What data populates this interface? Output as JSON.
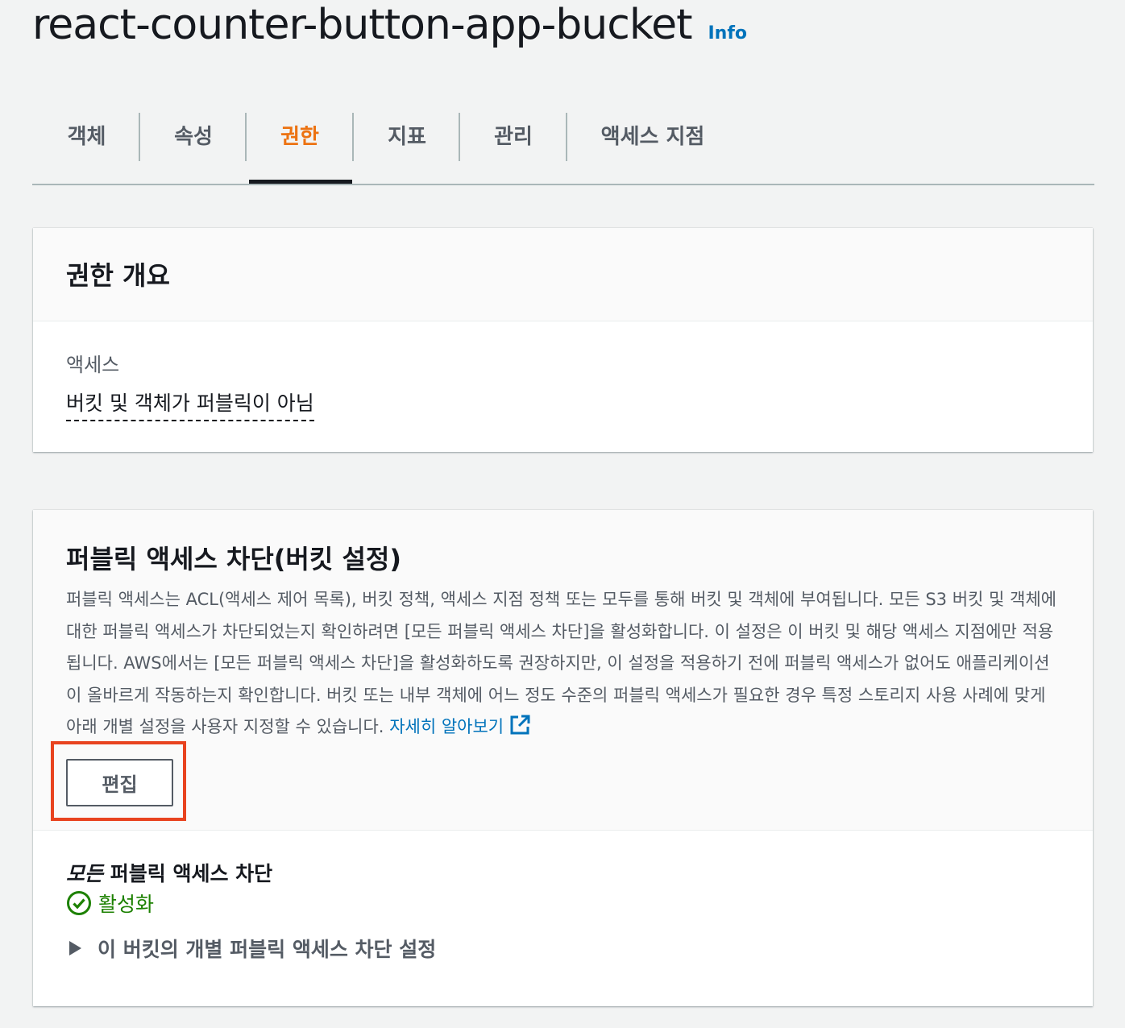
{
  "header": {
    "title": "react-counter-button-app-bucket",
    "info_label": "Info"
  },
  "tabs": [
    {
      "label": "객체"
    },
    {
      "label": "속성"
    },
    {
      "label": "권한",
      "active": true
    },
    {
      "label": "지표"
    },
    {
      "label": "관리"
    },
    {
      "label": "액세스 지점"
    }
  ],
  "overview": {
    "title": "권한 개요",
    "access_label": "액세스",
    "access_value": "버킷 및 객체가 퍼블릭이 아님"
  },
  "block_public_access": {
    "title": "퍼블릭 액세스 차단(버킷 설정)",
    "description": "퍼블릭 액세스는 ACL(액세스 제어 목록), 버킷 정책, 액세스 지점 정책 또는 모두를 통해 버킷 및 객체에 부여됩니다. 모든 S3 버킷 및 객체에 대한 퍼블릭 액세스가 차단되었는지 확인하려면 [모든 퍼블릭 액세스 차단]을 활성화합니다. 이 설정은 이 버킷 및 해당 액세스 지점에만 적용됩니다. AWS에서는 [모든 퍼블릭 액세스 차단]을 활성화하도록 권장하지만, 이 설정을 적용하기 전에 퍼블릭 액세스가 없어도 애플리케이션이 올바르게 작동하는지 확인합니다. 버킷 또는 내부 객체에 어느 정도 수준의 퍼블릭 액세스가 필요한 경우 특정 스토리지 사용 사례에 맞게 아래 개별 설정을 사용자 지정할 수 있습니다.",
    "learn_more_label": "자세히 알아보기",
    "edit_label": "편집",
    "block_all_prefix": "모든",
    "block_all_suffix": "퍼블릭 액세스 차단",
    "status_label": "활성화",
    "expander_label": "이 버킷의 개별 퍼블릭 액세스 차단 설정"
  },
  "colors": {
    "active_tab": "#ec7211",
    "link": "#0073bb",
    "success": "#1d8102",
    "highlight": "#e8431f"
  }
}
